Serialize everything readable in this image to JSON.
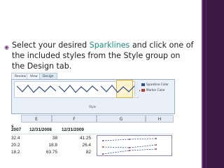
{
  "slide": {
    "bullet": "◉",
    "text_before": "Select your desired ",
    "highlight": "Sparklines",
    "text_after": " and click one of the included styles from the Style group on the Design tab."
  },
  "ribbon": {
    "tabs": [
      "Review",
      "View",
      "Design"
    ],
    "menu": [
      "Sparkline Color",
      "Marker Color"
    ],
    "group_label": "Style"
  },
  "sheet": {
    "columns": [
      "E",
      "F",
      "G",
      "H"
    ],
    "row_label": "s",
    "header_row": [
      "2007",
      "12/31/2008",
      "12/31/2009"
    ],
    "rows": [
      [
        "32.4",
        "38",
        "41.25"
      ],
      [
        "20.2",
        "18.8",
        "26.4"
      ],
      [
        "18.2",
        "63.75",
        "82"
      ]
    ]
  },
  "colors": {
    "sidebar": "#3d1a45",
    "highlight": "#1b8f80",
    "spark": "#2f4f8f",
    "marker": "#c0392b"
  }
}
